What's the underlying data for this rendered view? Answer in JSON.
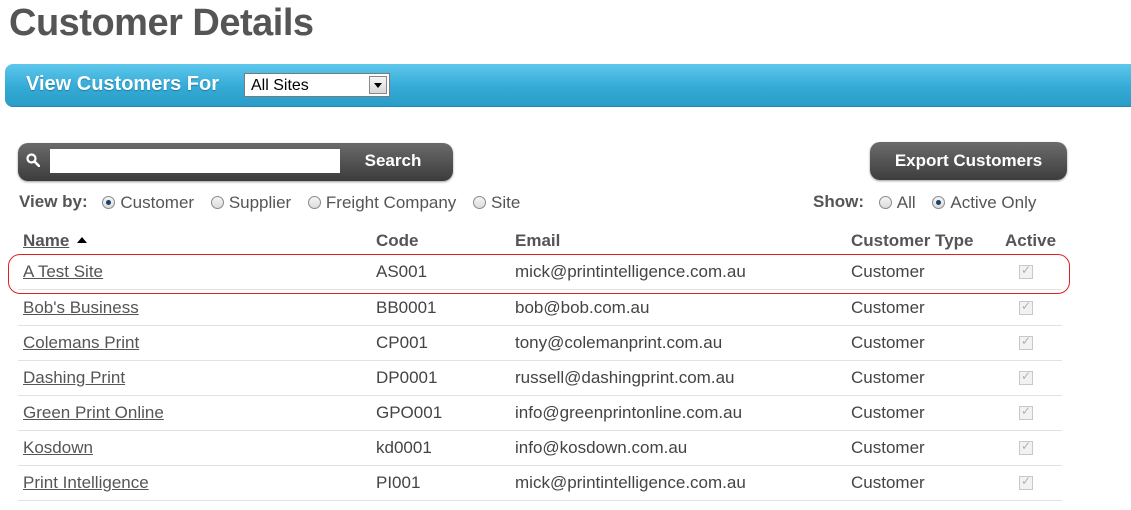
{
  "page": {
    "title": "Customer Details"
  },
  "filter": {
    "label": "View Customers For",
    "site_value": "All Sites"
  },
  "search": {
    "placeholder": "",
    "value": "",
    "button_label": "Search"
  },
  "export": {
    "label": "Export Customers"
  },
  "view_by": {
    "label": "View by:",
    "options": [
      {
        "label": "Customer",
        "checked": true
      },
      {
        "label": "Supplier",
        "checked": false
      },
      {
        "label": "Freight Company",
        "checked": false
      },
      {
        "label": "Site",
        "checked": false
      }
    ]
  },
  "show": {
    "label": "Show:",
    "options": [
      {
        "label": "All",
        "checked": false
      },
      {
        "label": "Active Only",
        "checked": true
      }
    ]
  },
  "table": {
    "headers": {
      "name": "Name",
      "code": "Code",
      "email": "Email",
      "type": "Customer Type",
      "active": "Active"
    },
    "rows": [
      {
        "name": "A Test Site",
        "code": "AS001",
        "email": "mick@printintelligence.com.au",
        "type": "Customer",
        "active": true
      },
      {
        "name": "Bob's Business",
        "code": "BB0001",
        "email": "bob@bob.com.au",
        "type": "Customer",
        "active": true
      },
      {
        "name": "Colemans Print",
        "code": "CP001",
        "email": "tony@colemanprint.com.au",
        "type": "Customer",
        "active": true
      },
      {
        "name": "Dashing Print",
        "code": "DP0001",
        "email": "russell@dashingprint.com.au",
        "type": "Customer",
        "active": true
      },
      {
        "name": "Green Print Online",
        "code": "GPO001",
        "email": "info@greenprintonline.com.au",
        "type": "Customer",
        "active": true
      },
      {
        "name": "Kosdown",
        "code": "kd0001",
        "email": "info@kosdown.com.au",
        "type": "Customer",
        "active": true
      },
      {
        "name": "Print Intelligence",
        "code": "PI001",
        "email": "mick@printintelligence.com.au",
        "type": "Customer",
        "active": true
      }
    ]
  },
  "colors": {
    "accent_bar": "#34abd6",
    "highlight_ring": "#e02020",
    "button_dark": "#4a4a4a"
  }
}
